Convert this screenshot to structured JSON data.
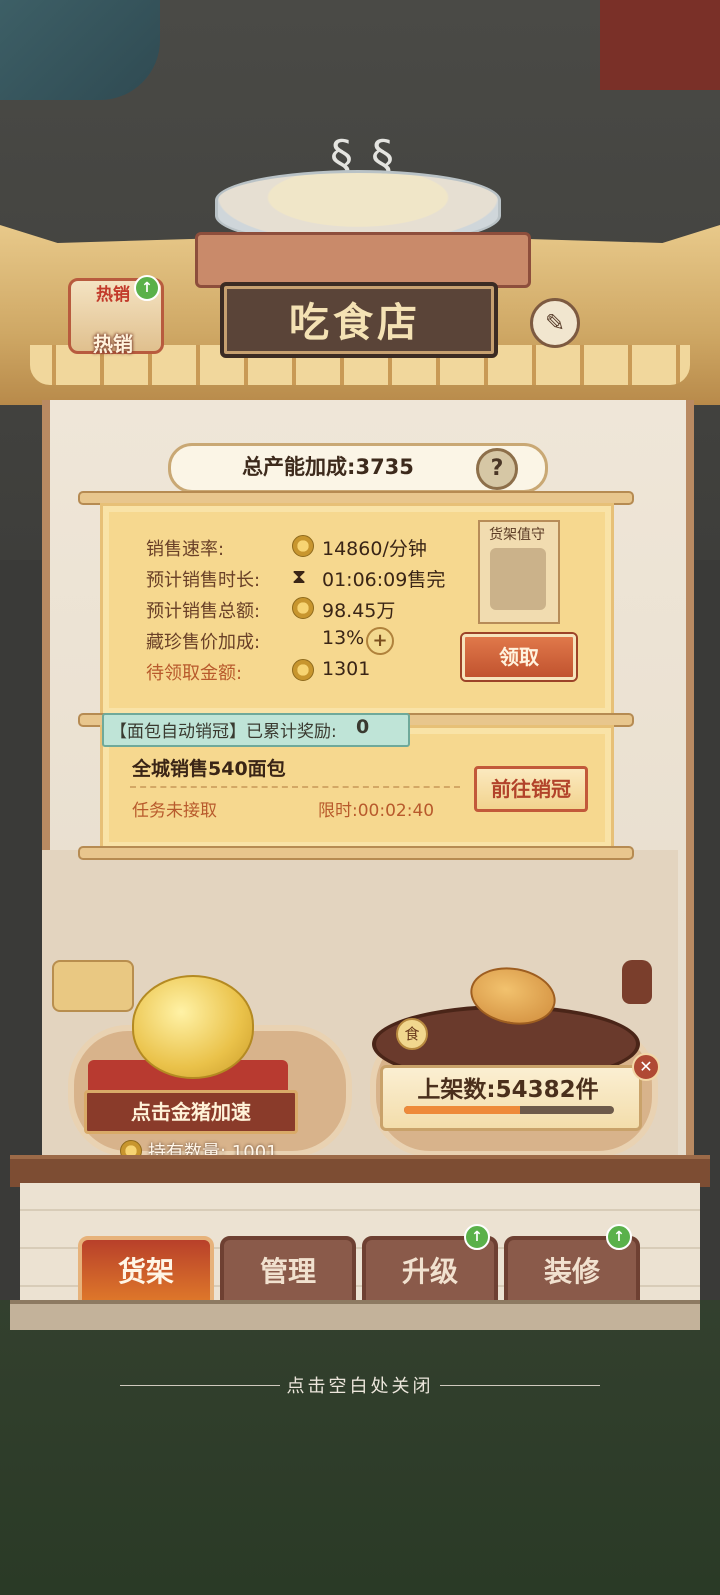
{
  "shop": {
    "title": "吃食店",
    "hot_badge_top": "热销",
    "hot_badge_label": "热销",
    "total_capacity": "总产能加成:3735",
    "help": "?"
  },
  "stats": {
    "rate_label": "销售速率:",
    "rate_value": "14860/分钟",
    "duration_label": "预计销售时长:",
    "duration_value": "01:06:09售完",
    "total_label": "预计销售总额:",
    "total_value": "98.45万",
    "bonus_label": "藏珍售价加成:",
    "bonus_value": "13%",
    "pending_label": "待领取金额:",
    "pending_value": "1301",
    "guard_title": "货架值守",
    "claim_button": "领取"
  },
  "task": {
    "auto_label": "【面包自动销冠】已累计奖励:",
    "auto_count": "0",
    "name": "全城销售540面包",
    "status": "任务未接取",
    "time_limit": "限时:00:02:40",
    "goto_button": "前往销冠"
  },
  "pig": {
    "button": "点击金猪加速",
    "hold_text": "持有数量: 1001"
  },
  "shelf": {
    "food_badge": "食",
    "count_text": "上架数:54382件",
    "progress": 0.55
  },
  "tabs": [
    "货架",
    "管理",
    "升级",
    "装修"
  ],
  "close_hint": "点击空白处关闭",
  "colors": {
    "accent_red": "#c1532f",
    "card_bg": "#f6d88f",
    "progress_orange": "#ee8a3a"
  }
}
